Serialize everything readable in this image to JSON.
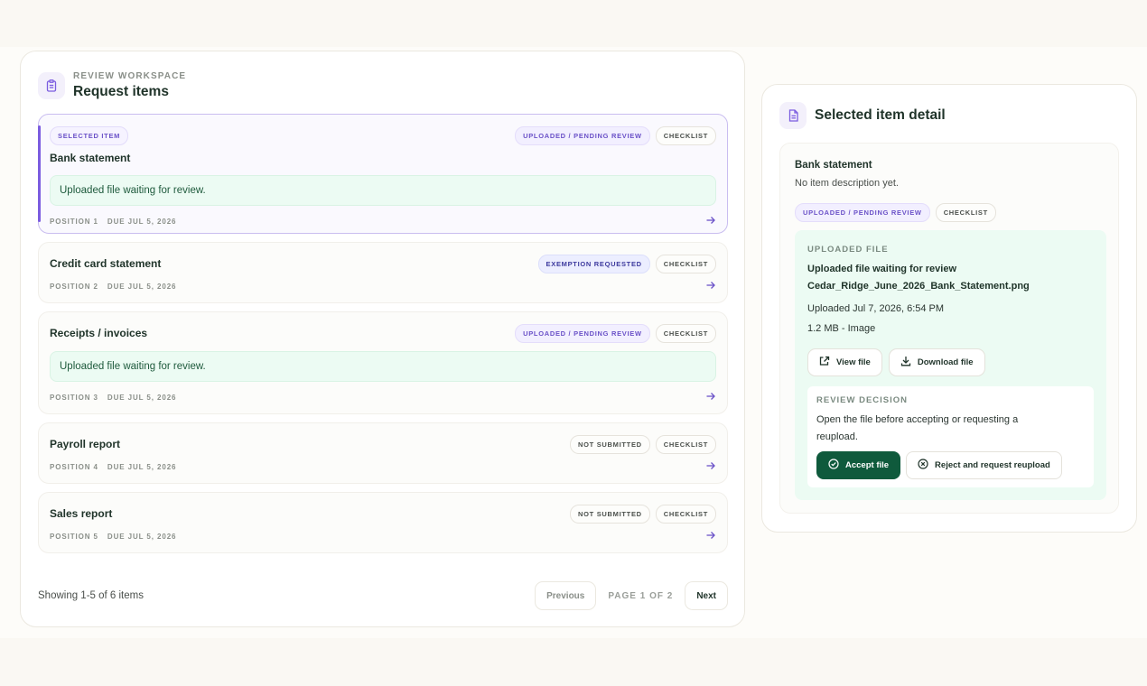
{
  "workspace": {
    "eyebrow": "REVIEW WORKSPACE",
    "title": "Request items",
    "icon": "clipboard-icon"
  },
  "items": [
    {
      "name": "Bank statement",
      "tag": "SELECTED ITEM",
      "status": "UPLOADED / PENDING REVIEW",
      "type": "CHECKLIST",
      "notice": "Uploaded file waiting for review.",
      "position": "POSITION 1",
      "due": "DUE JUL 5, 2026"
    },
    {
      "name": "Credit card statement",
      "status": "EXEMPTION REQUESTED",
      "type": "CHECKLIST",
      "position": "POSITION 2",
      "due": "DUE JUL 5, 2026"
    },
    {
      "name": "Receipts / invoices",
      "status": "UPLOADED / PENDING REVIEW",
      "type": "CHECKLIST",
      "notice": "Uploaded file waiting for review.",
      "position": "POSITION 3",
      "due": "DUE JUL 5, 2026"
    },
    {
      "name": "Payroll report",
      "status": "NOT SUBMITTED",
      "type": "CHECKLIST",
      "position": "POSITION 4",
      "due": "DUE JUL 5, 2026"
    },
    {
      "name": "Sales report",
      "status": "NOT SUBMITTED",
      "type": "CHECKLIST",
      "position": "POSITION 5",
      "due": "DUE JUL 5, 2026"
    }
  ],
  "pagination": {
    "showing": "Showing 1-5 of 6 items",
    "previous": "Previous",
    "page_label": "PAGE 1 OF 2",
    "next": "Next"
  },
  "detail": {
    "title": "Selected item detail",
    "icon": "document-icon",
    "item_name": "Bank statement",
    "description": "No item description yet.",
    "status": "UPLOADED / PENDING REVIEW",
    "type": "CHECKLIST",
    "file": {
      "eyebrow": "UPLOADED FILE",
      "heading": "Uploaded file waiting for review",
      "filename": "Cedar_Ridge_June_2026_Bank_Statement.png",
      "uploaded": "Uploaded Jul 7, 2026, 6:54 PM",
      "size": "1.2 MB - Image",
      "view_label": "View file",
      "download_label": "Download file"
    },
    "decision": {
      "eyebrow": "REVIEW DECISION",
      "text": "Open the file before accepting or requesting a reupload.",
      "accept_label": "Accept file",
      "reject_label": "Reject and request reupload"
    }
  },
  "colors": {
    "accent_purple": "#7b5ce0",
    "accept_green": "#0f5a3c",
    "notice_bg": "#ecfbf3"
  }
}
